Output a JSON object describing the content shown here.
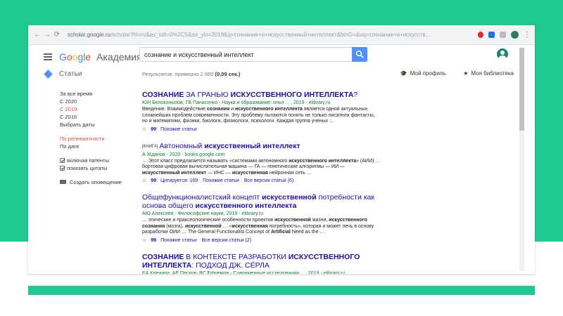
{
  "browser": {
    "url_host": "scholar.google.ru",
    "url_path": "/scholar?hl=ru&as_sdt=0%2C5&as_ylo=2019&q=сознание+и+искусственный+интеллект&btnG=&oq=сознание+и+искусств..."
  },
  "header": {
    "logo_google": "Google",
    "logo_product": "Академия",
    "search_value": "сознание и искусственный интеллект"
  },
  "subheader": {
    "section_label": "Статьи",
    "results_prefix": "Результатов: примерно 2 860 ",
    "results_time": "(0,09 сек.)",
    "my_profile": "Мой профиль",
    "my_library": "Моя библиотека"
  },
  "sidebar": {
    "any_time": "За все время",
    "since_2020": "С 2020",
    "since_2019": "С 2019",
    "since_2016": "С 2016",
    "pick_dates": "Выбрать даты",
    "by_relevance": "По релевантности",
    "by_date": "По дате",
    "include_patents": "включая патенты",
    "show_citations": "показать цитаты",
    "create_alert": "Создать оповещение"
  },
  "results": [
    {
      "title": [
        {
          "t": "СОЗНАНИЕ",
          "b": true
        },
        {
          "t": " ЗА ГРАНЬЮ ",
          "b": false
        },
        {
          "t": "ИСКУССТВЕННОГО ИНТЕЛЛЕКТА",
          "b": true
        },
        {
          "t": "?",
          "b": false
        }
      ],
      "authors": "ЮН Белоконыпов, ГВ Панасенко - Наука и образование: опыт …, 2019 - elibrary.ru",
      "snippet": [
        {
          "t": "Введение. Взаимодействие ",
          "b": false
        },
        {
          "t": "сознания",
          "b": true
        },
        {
          "t": " и ",
          "b": false
        },
        {
          "t": "искусственного интеллекта",
          "b": true
        },
        {
          "t": " является одной актуальных сложнейших проблем современности. Эту проблему пытаются понять не только писатели фантасты, но и математики, физики, биологи, физиологи, психологи. Каждая группа ученых …",
          "b": false
        }
      ],
      "similar": "Похожие статьи"
    },
    {
      "tag": "[КНИГА]",
      "title": [
        {
          "t": "Автономный ",
          "b": false
        },
        {
          "t": "искусственный интеллект",
          "b": true
        }
      ],
      "authors": "А Жданов - 2020 - books.google.com",
      "snippet": [
        {
          "t": "… Этот класс предлагается называть «системами автономного ",
          "b": false
        },
        {
          "t": "искусственного интеллекта",
          "b": true
        },
        {
          "t": "» (АИИ) … бортовая цифровая вычислительная машина — ГА — генетические алгоритмы — ИИ — ",
          "b": false
        },
        {
          "t": "искусственный интеллект",
          "b": true
        },
        {
          "t": " — ИНС — ",
          "b": false
        },
        {
          "t": "искусственная",
          "b": true
        },
        {
          "t": " нейронная сеть …",
          "b": false
        }
      ],
      "cited": "Цитируется: 169",
      "similar": "Похожие статьи",
      "versions": "Все версии статьи (6)"
    },
    {
      "title": [
        {
          "t": "Общефункционалистский концепт ",
          "b": false
        },
        {
          "t": "искусственной",
          "b": true
        },
        {
          "t": " потребности как основа общего ",
          "b": false
        },
        {
          "t": "искусственного интеллекта",
          "b": true
        }
      ],
      "authors": "АЮ Алексеев - Философские науки, 2019 - elibrary.ru",
      "snippet": [
        {
          "t": "… этические и праксеологические особенности проектов ",
          "b": false
        },
        {
          "t": "искусственной",
          "b": true
        },
        {
          "t": " жизни, ",
          "b": false
        },
        {
          "t": "искусственного сознания",
          "b": true
        },
        {
          "t": " (мозга), ",
          "b": false
        },
        {
          "t": "искусственной",
          "b": true
        },
        {
          "t": " … «",
          "b": false
        },
        {
          "t": "искусственная",
          "b": true
        },
        {
          "t": " потребность», которая и может лечь в основу разработки ОИИ … The General Functionalist Concept of ",
          "b": false
        },
        {
          "t": "Artificial",
          "b": true
        },
        {
          "t": " Need as the …",
          "b": false
        }
      ],
      "similar": "Похожие статьи",
      "versions": "Все версии статьи (2)"
    },
    {
      "title": [
        {
          "t": "СОЗНАНИЕ",
          "b": true
        },
        {
          "t": " В КОНТЕКСТЕ РАЗРАБОТКИ ",
          "b": false
        },
        {
          "t": "ИСКУССТВЕННОГО ИНТЕЛЛЕКТА",
          "b": true
        },
        {
          "t": ": ПОДХОД ДЖ. СЁРЛА",
          "b": false
        }
      ],
      "authors": "ЕА Кленина, АЕ Песков, ВС Ефремов - Современные исследования …, 2019 - elibrary.ru"
    }
  ]
}
